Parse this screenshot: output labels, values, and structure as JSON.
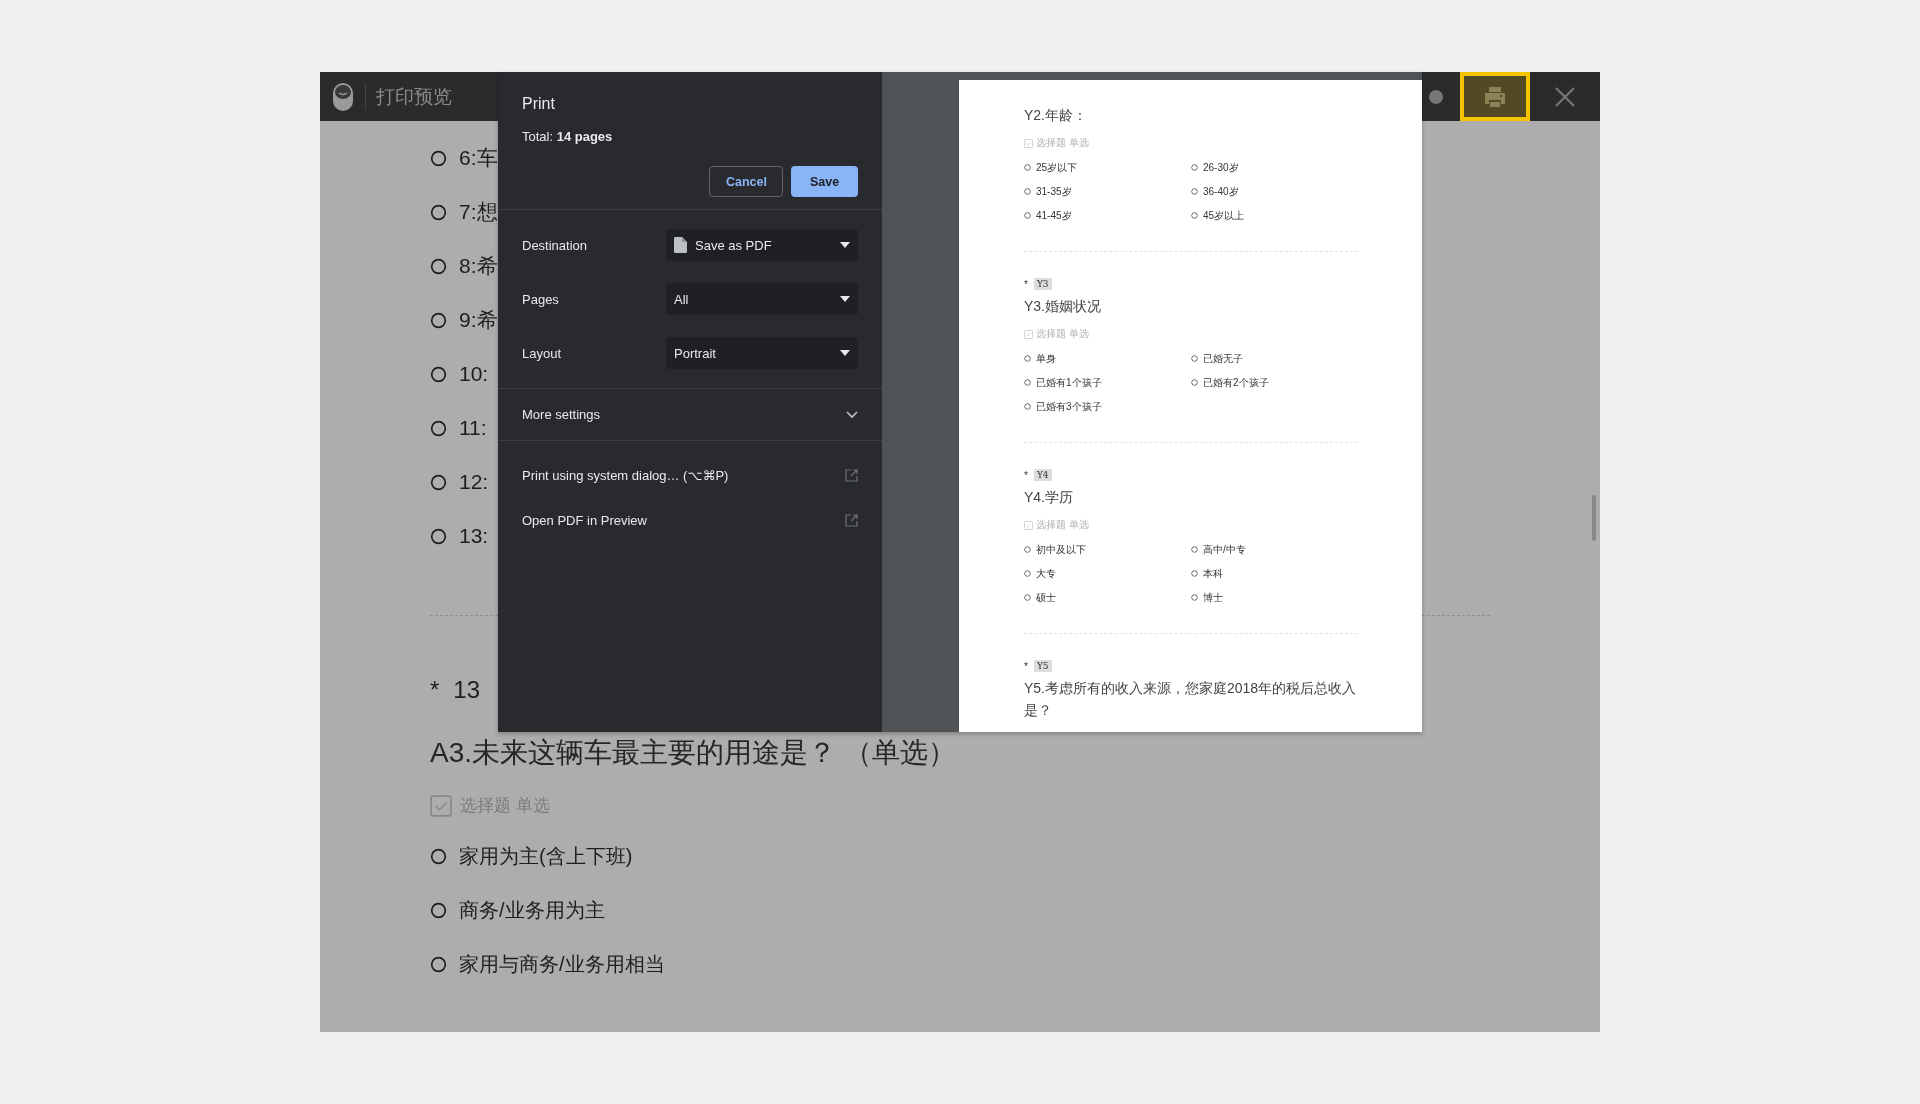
{
  "app_bar": {
    "title": "打印预览",
    "tools": [
      {
        "kind": "print",
        "selected": true
      },
      {
        "kind": "close",
        "selected": false
      }
    ]
  },
  "background_survey": {
    "options": [
      "6:车",
      "7:想",
      "8:希",
      "9:希",
      "10:",
      "11:",
      "12:",
      "13:"
    ],
    "question": {
      "required_mark": "*",
      "number": "13",
      "title": "A3.未来这辆车最主要的用途是？ （单选）",
      "type_tag": "选择题 单选",
      "options": [
        "家用为主(含上下班)",
        "商务/业务用为主",
        "家用与商务/业务用相当"
      ]
    }
  },
  "print_dialog": {
    "title": "Print",
    "total": "Total: **14 pages**",
    "buttons": [
      {
        "label": "Cancel",
        "kind": "secondary"
      },
      {
        "label": "Save",
        "kind": "primary"
      }
    ],
    "settings": [
      {
        "label": "Destination",
        "value": "Save as PDF",
        "kind": "file-select"
      },
      {
        "label": "Pages",
        "value": "All",
        "kind": "select"
      },
      {
        "label": "Layout",
        "value": "Portrait",
        "kind": "select"
      }
    ],
    "more_settings": {
      "label": "More settings",
      "expanded": false
    },
    "links": [
      "Print using system dialog… (⌥⌘P)",
      "Open PDF in Preview"
    ]
  },
  "preview_page": {
    "questions": [
      {
        "title": "Y2.年龄：",
        "type_tag": "选择题 单选",
        "options": [
          "25岁以下",
          "26-30岁",
          "31-35岁",
          "36-40岁",
          "41-45岁",
          "45岁以上"
        ]
      },
      {
        "required_mark": "*",
        "code": "Y3",
        "title": "Y3.婚姻状况",
        "type_tag": "选择题 单选",
        "options": [
          "单身",
          "已婚无子",
          "已婚有1个孩子",
          "已婚有2个孩子",
          "已婚有3个孩子"
        ]
      },
      {
        "required_mark": "*",
        "code": "Y4",
        "title": "Y4.学历",
        "type_tag": "选择题 单选",
        "options": [
          "初中及以下",
          "高中/中专",
          "大专",
          "本科",
          "硕士",
          "博士"
        ]
      },
      {
        "required_mark": "*",
        "code": "Y5",
        "title": "Y5.考虑所有的收入来源，您家庭2018年的税后总收入是？"
      }
    ]
  }
}
